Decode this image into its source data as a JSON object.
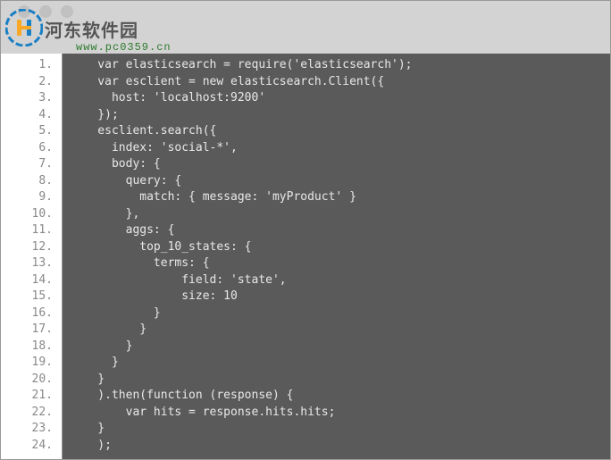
{
  "watermark": {
    "title": "河东软件园",
    "url": "www.pc0359.cn"
  },
  "line_numbers": [
    "1.",
    "2.",
    "3.",
    "4.",
    "5.",
    "6.",
    "7.",
    "8.",
    "9.",
    "10.",
    "11.",
    "12.",
    "13.",
    "14.",
    "15.",
    "16.",
    "17.",
    "18.",
    "19.",
    "20.",
    "21.",
    "22.",
    "23.",
    "24."
  ],
  "code_lines": [
    "    var elasticsearch = require('elasticsearch');",
    "    var esclient = new elasticsearch.Client({",
    "      host: 'localhost:9200'",
    "    });",
    "    esclient.search({",
    "      index: 'social-*',",
    "      body: {",
    "        query: {",
    "          match: { message: 'myProduct' }",
    "        },",
    "        aggs: {",
    "          top_10_states: {",
    "            terms: {",
    "                field: 'state',",
    "                size: 10",
    "            }",
    "          }",
    "        }",
    "      }",
    "    }",
    "    ).then(function (response) {",
    "        var hits = response.hits.hits;",
    "    }",
    "    );"
  ]
}
